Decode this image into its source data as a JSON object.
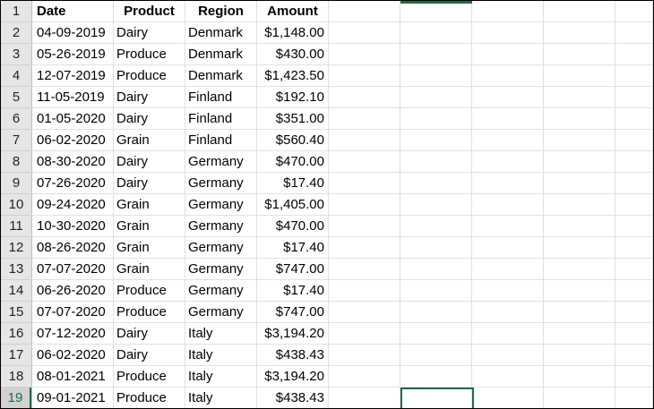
{
  "sheet": {
    "row_numbers": [
      "1",
      "2",
      "3",
      "4",
      "5",
      "6",
      "7",
      "8",
      "9",
      "10",
      "11",
      "12",
      "13",
      "14",
      "15",
      "16",
      "17",
      "18",
      "19"
    ],
    "active_row": "19",
    "headers": [
      "Date",
      "Product",
      "Region",
      "Amount"
    ],
    "rows": [
      [
        "04-09-2019",
        "Dairy",
        "Denmark",
        "$1,148.00"
      ],
      [
        "05-26-2019",
        "Produce",
        "Denmark",
        "$430.00"
      ],
      [
        "12-07-2019",
        "Produce",
        "Denmark",
        "$1,423.50"
      ],
      [
        "11-05-2019",
        "Dairy",
        "Finland",
        "$192.10"
      ],
      [
        "01-05-2020",
        "Dairy",
        "Finland",
        "$351.00"
      ],
      [
        "06-02-2020",
        "Grain",
        "Finland",
        "$560.40"
      ],
      [
        "08-30-2020",
        "Dairy",
        "Germany",
        "$470.00"
      ],
      [
        "07-26-2020",
        "Dairy",
        "Germany",
        "$17.40"
      ],
      [
        "09-24-2020",
        "Grain",
        "Germany",
        "$1,405.00"
      ],
      [
        "10-30-2020",
        "Grain",
        "Germany",
        "$470.00"
      ],
      [
        "08-26-2020",
        "Grain",
        "Germany",
        "$17.40"
      ],
      [
        "07-07-2020",
        "Grain",
        "Germany",
        "$747.00"
      ],
      [
        "06-26-2020",
        "Produce",
        "Germany",
        "$17.40"
      ],
      [
        "07-07-2020",
        "Produce",
        "Germany",
        "$747.00"
      ],
      [
        "07-12-2020",
        "Dairy",
        "Italy",
        "$3,194.20"
      ],
      [
        "06-02-2020",
        "Dairy",
        "Italy",
        "$438.43"
      ],
      [
        "08-01-2021",
        "Produce",
        "Italy",
        "$3,194.20"
      ],
      [
        "09-01-2021",
        "Produce",
        "Italy",
        "$438.43"
      ]
    ],
    "colors": {
      "accent": "#1e6b43",
      "row_header_bg": "#e6e6e6",
      "gridline": "#e1e1e1"
    }
  }
}
